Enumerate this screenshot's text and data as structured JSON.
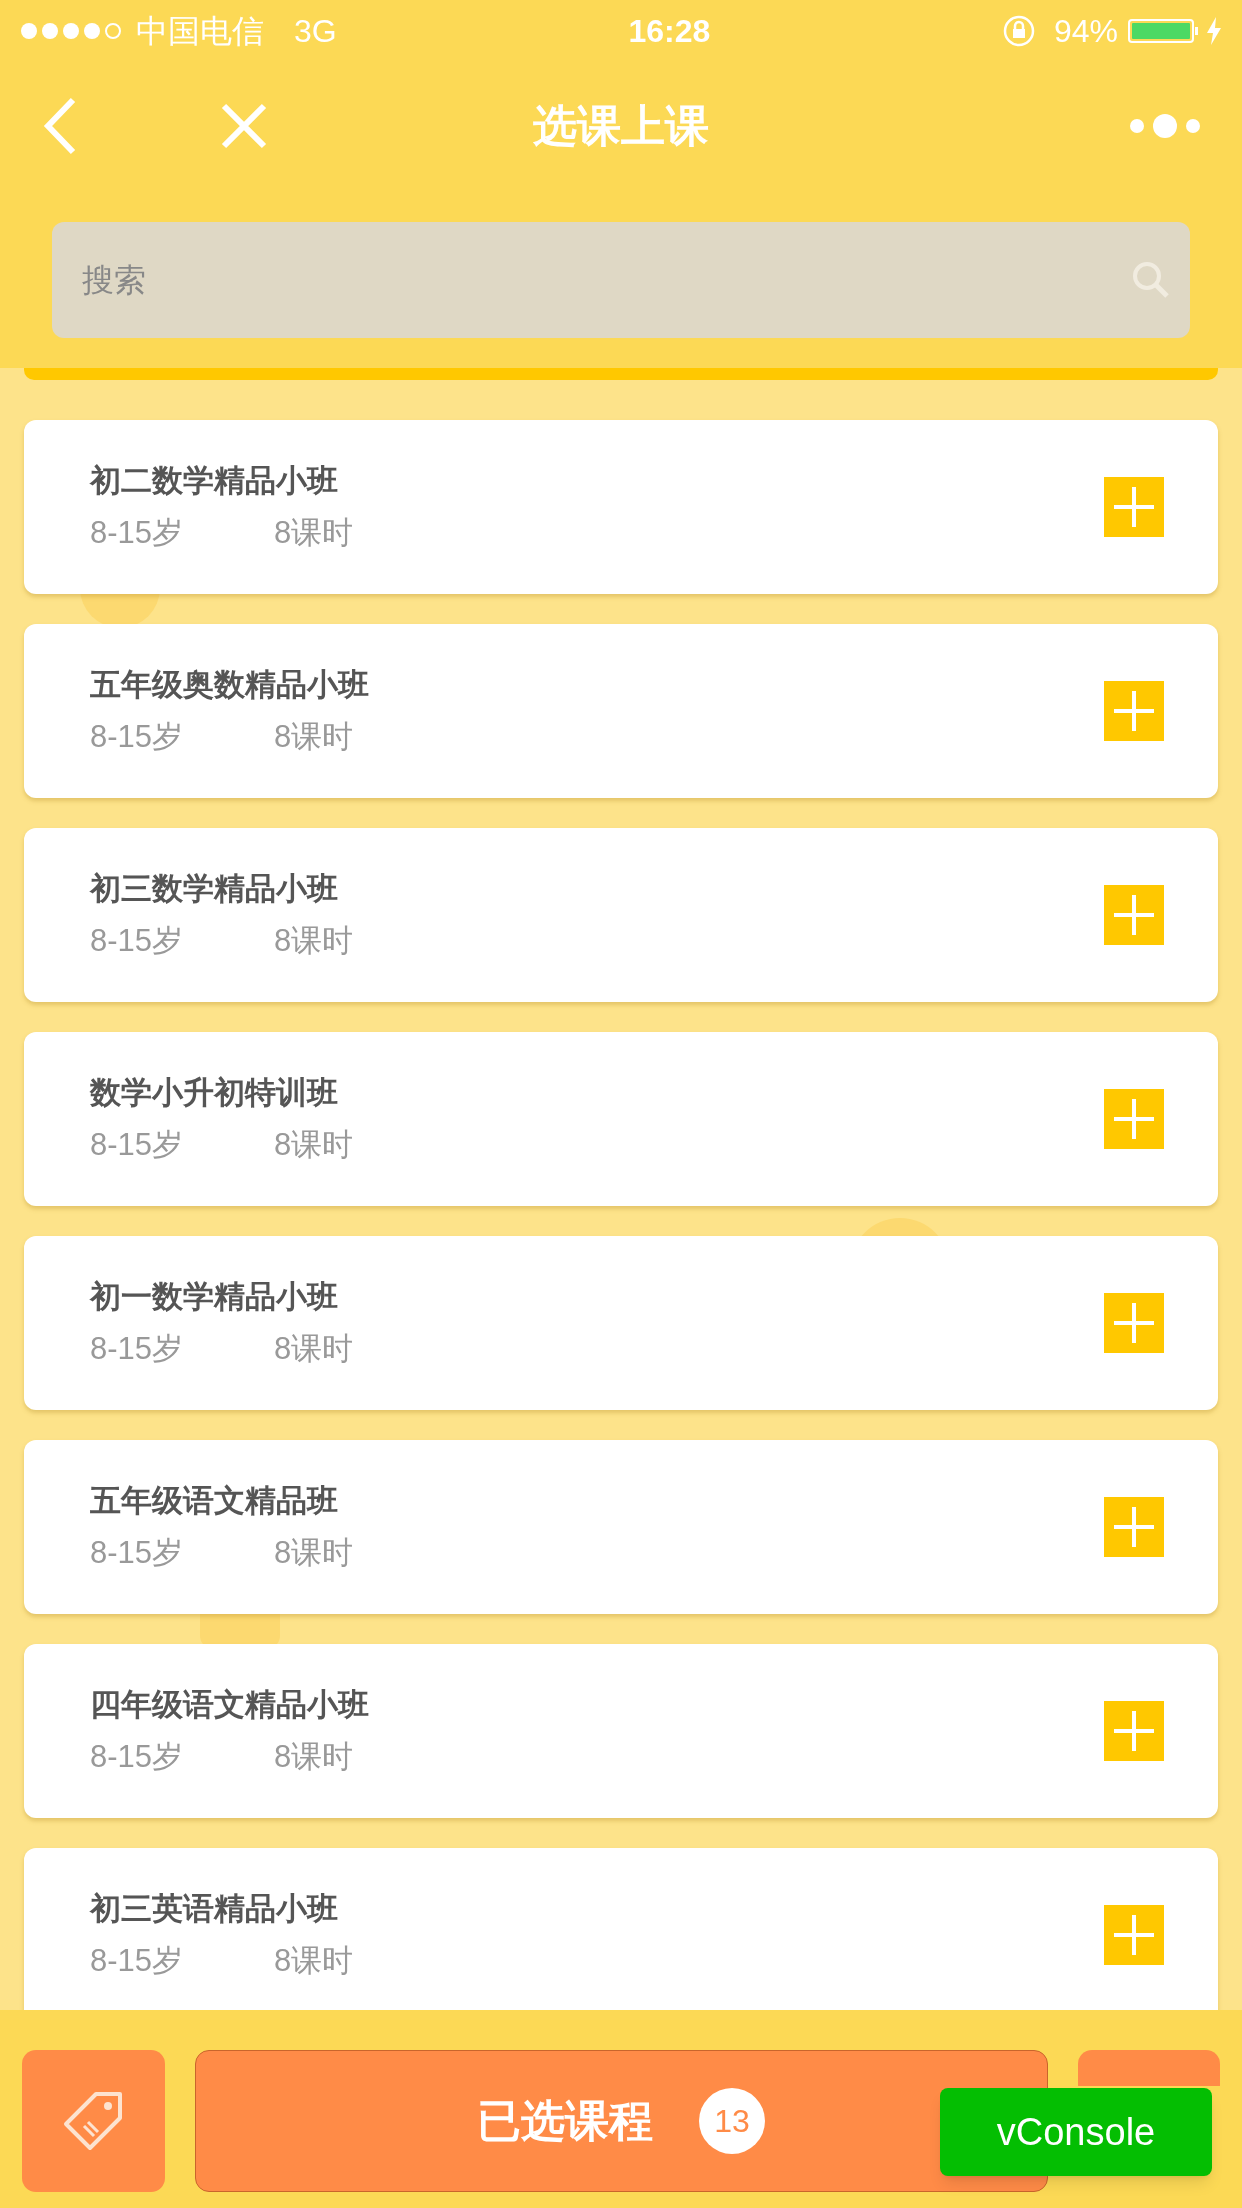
{
  "status_bar": {
    "carrier": "中国电信",
    "network": "3G",
    "time": "16:28",
    "battery": "94%"
  },
  "nav": {
    "title": "选课上课"
  },
  "search": {
    "placeholder": "搜索"
  },
  "courses": [
    {
      "name": "初二数学精品小班",
      "age": "8-15岁",
      "hours": "8课时"
    },
    {
      "name": "五年级奥数精品小班",
      "age": "8-15岁",
      "hours": "8课时"
    },
    {
      "name": "初三数学精品小班",
      "age": "8-15岁",
      "hours": "8课时"
    },
    {
      "name": "数学小升初特训班",
      "age": "8-15岁",
      "hours": "8课时"
    },
    {
      "name": "初一数学精品小班",
      "age": "8-15岁",
      "hours": "8课时"
    },
    {
      "name": "五年级语文精品班",
      "age": "8-15岁",
      "hours": "8课时"
    },
    {
      "name": "四年级语文精品小班",
      "age": "8-15岁",
      "hours": "8课时"
    },
    {
      "name": "初三英语精品小班",
      "age": "8-15岁",
      "hours": "8课时"
    }
  ],
  "bottom_bar": {
    "selected_label": "已选课程",
    "selected_count": "13"
  },
  "vconsole": {
    "label": "vConsole"
  }
}
